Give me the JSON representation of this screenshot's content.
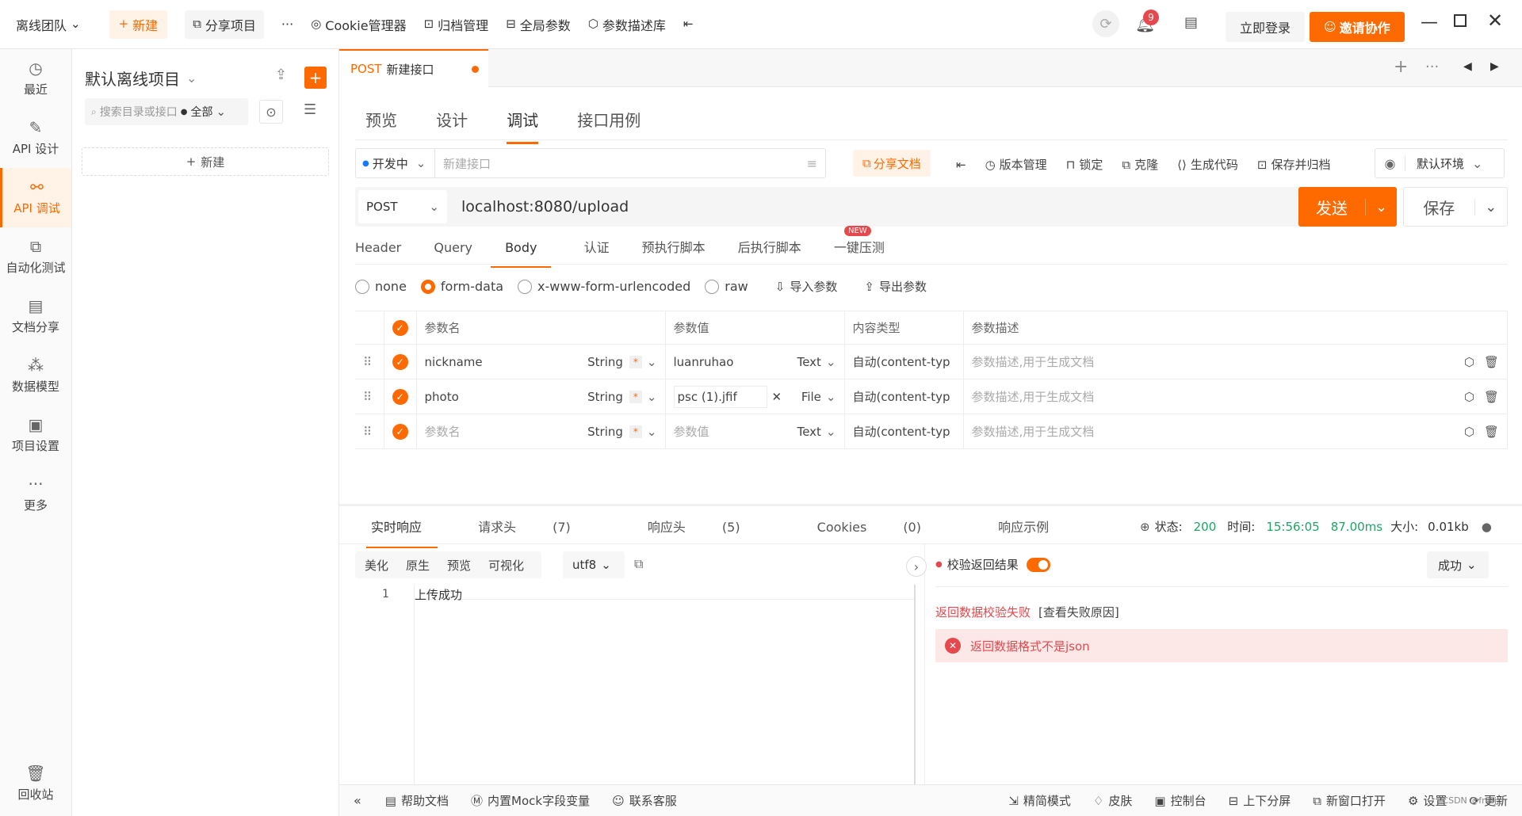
{
  "titlebar": {
    "team": "离线团队",
    "new_label": "新建",
    "share_label": "分享项目",
    "more": "···",
    "cookie_label": "Cookie管理器",
    "archive_label": "归档管理",
    "global_label": "全局参数",
    "paramlib_label": "参数描述库",
    "notif_count": "9",
    "login_label": "立即登录",
    "invite_label": "邀请协作"
  },
  "sidebar": {
    "items": [
      {
        "label": "最近",
        "icon": "clock-icon"
      },
      {
        "label": "API 设计",
        "icon": "edit-icon"
      },
      {
        "label": "API 调试",
        "icon": "link-icon"
      },
      {
        "label": "自动化测试",
        "icon": "flow-icon"
      },
      {
        "label": "文档分享",
        "icon": "doc-icon"
      },
      {
        "label": "数据模型",
        "icon": "model-icon"
      },
      {
        "label": "项目设置",
        "icon": "folder-settings-icon"
      },
      {
        "label": "更多",
        "icon": "more-icon"
      }
    ],
    "trash_label": "回收站"
  },
  "project": {
    "name": "默认离线项目",
    "search_placeholder": "搜索目录或接口",
    "filter_label": "全部",
    "new_label": "新建"
  },
  "tab": {
    "method": "POST",
    "title": "新建接口"
  },
  "mode_tabs": [
    "预览",
    "设计",
    "调试",
    "接口用例"
  ],
  "toolbar": {
    "status": "开发中",
    "name_placeholder": "新建接口",
    "share_doc": "分享文档",
    "version": "版本管理",
    "lock": "锁定",
    "clone": "克隆",
    "gen_code": "生成代码",
    "save_archive": "保存并归档",
    "env": "默认环境"
  },
  "request": {
    "method": "POST",
    "url": "localhost:8080/upload",
    "send_label": "发送",
    "save_label": "保存"
  },
  "sub_tabs": [
    "Header",
    "Query",
    "Body",
    "认证",
    "预执行脚本",
    "后执行脚本",
    "一键压测"
  ],
  "new_badge": "NEW",
  "body_types": [
    "none",
    "form-data",
    "x-www-form-urlencoded",
    "raw"
  ],
  "import_label": "导入参数",
  "export_label": "导出参数",
  "params": {
    "headers": [
      "参数名",
      "参数值",
      "内容类型",
      "参数描述"
    ],
    "rows": [
      {
        "name": "nickname",
        "type": "String",
        "value": "luanruhao",
        "vtype": "Text",
        "ctype": "自动(content-typ",
        "desc": "参数描述,用于生成文档"
      },
      {
        "name": "photo",
        "type": "String",
        "value": "psc (1).jfif",
        "vtype": "File",
        "ctype": "自动(content-typ",
        "desc": "参数描述,用于生成文档"
      },
      {
        "name": "参数名",
        "type": "String",
        "value": "参数值",
        "vtype": "Text",
        "ctype": "自动(content-typ",
        "desc": "参数描述,用于生成文档"
      }
    ]
  },
  "response": {
    "tabs": [
      "实时响应",
      "请求头",
      "响应头",
      "Cookies",
      "响应示例"
    ],
    "tab_counts": [
      "",
      "(7)",
      "(5)",
      "(0)",
      ""
    ],
    "status_label": "状态:",
    "status": "200",
    "time_label": "时间:",
    "time": "15:56:05",
    "duration": "87.00ms",
    "size_label": "大小:",
    "size": "0.01kb",
    "format_tabs": [
      "美化",
      "原生",
      "预览",
      "可视化"
    ],
    "encoding": "utf8",
    "line_no": "1",
    "body": "上传成功",
    "validate_label": "校验返回结果",
    "result_select": "成功",
    "fail_text": "返回数据校验失败",
    "fail_link": "[查看失败原因]",
    "error_msg": "返回数据格式不是json"
  },
  "bottombar": {
    "help": "帮助文档",
    "mock": "内置Mock字段变量",
    "support": "联系客服",
    "simple": "精简模式",
    "skin": "皮肤",
    "console": "控制台",
    "split": "上下分屏",
    "newwin": "新窗口打开",
    "settings": "设置",
    "update": "更新",
    "watermark": "CSDN @fnizj"
  },
  "colors": {
    "accent": "#ff6a00",
    "success": "#21a366",
    "error": "#e5484d"
  }
}
